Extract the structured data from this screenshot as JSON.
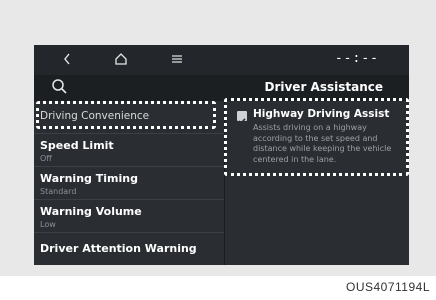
{
  "topbar": {
    "back_icon": "chevron-left-icon",
    "home_icon": "home-icon",
    "menu_icon": "menu-icon",
    "clock": "--:--"
  },
  "subbar": {
    "search_icon": "search-icon",
    "title": "Driver Assistance"
  },
  "menu": {
    "items": [
      {
        "label": "Driving Convenience",
        "value": ""
      },
      {
        "label": "Speed Limit",
        "value": "Off"
      },
      {
        "label": "Warning Timing",
        "value": "Standard"
      },
      {
        "label": "Warning Volume",
        "value": "Low"
      },
      {
        "label": "Driver Attention Warning",
        "value": ""
      }
    ]
  },
  "detail": {
    "option_title": "Highway Driving Assist",
    "option_checked": true,
    "option_description": "Assists driving on a highway according to the set speed and distance while keeping the vehicle centered in the lane."
  },
  "caption": "OUS4071194L",
  "colors": {
    "screen_bg": "#2a2e33",
    "topbar_bg": "#23272b",
    "highlight_border": "#ffffff"
  }
}
